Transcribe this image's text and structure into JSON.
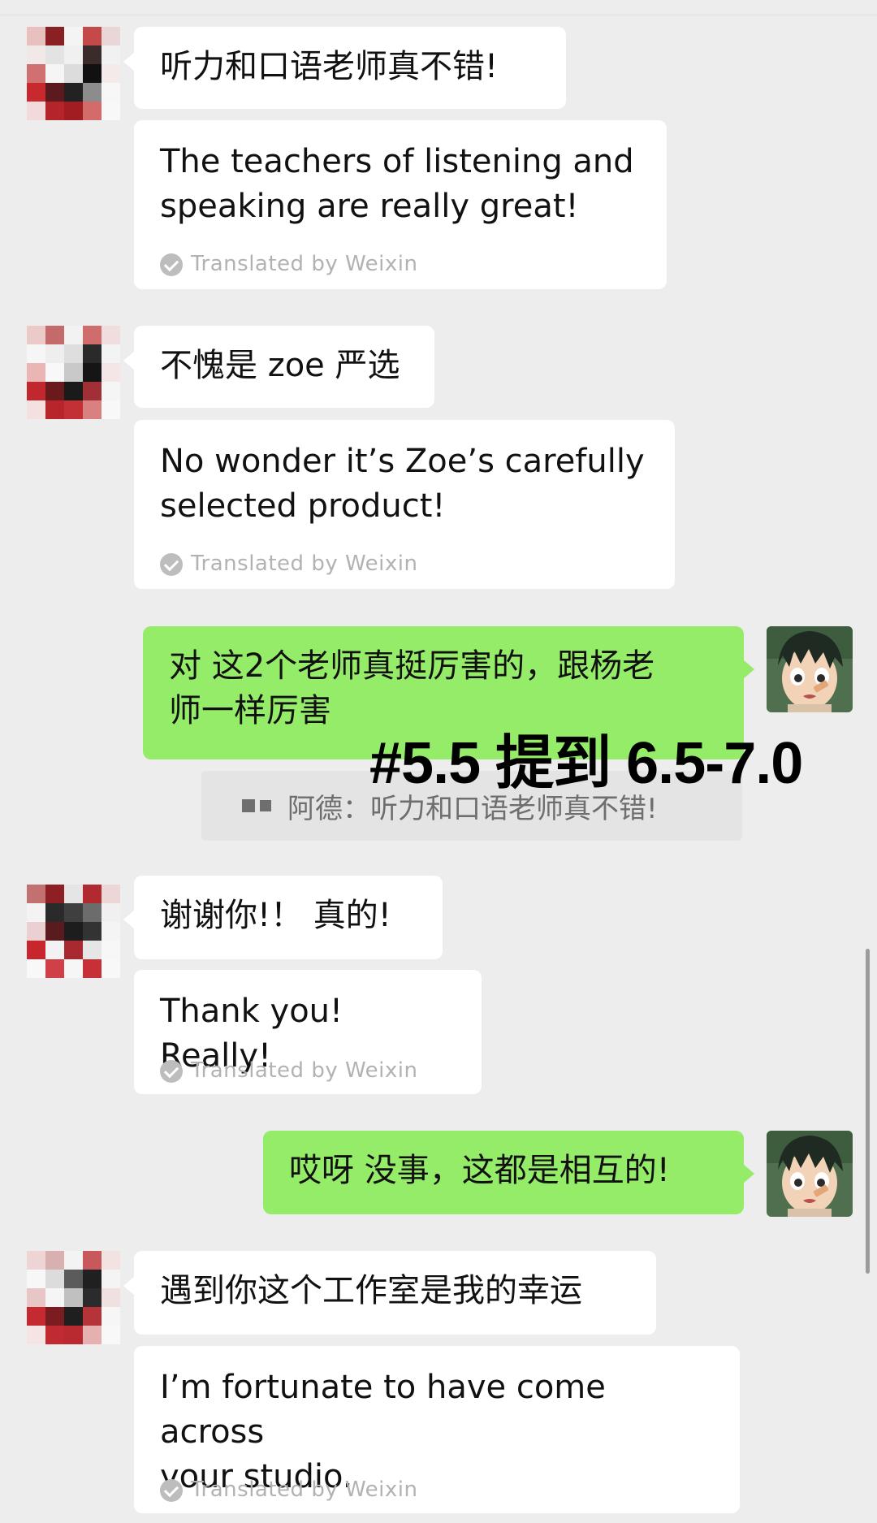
{
  "colors": {
    "background": "#ededed",
    "incoming_bubble": "#ffffff",
    "outgoing_bubble": "#95ec69",
    "translation_label": "#b2b2b2",
    "quote_background": "#e4e4e4",
    "overlay_text": "#000000"
  },
  "messages": {
    "m1": {
      "text": "听力和口语老师真不错!",
      "translation": "The teachers of listening and\nspeaking are really great!",
      "translation_label": "Translated by Weixin"
    },
    "m2": {
      "text": "不愧是 zoe 严选",
      "translation": "No wonder it’s Zoe’s carefully\nselected product!",
      "translation_label": "Translated by Weixin"
    },
    "m3": {
      "text": "对 这2个老师真挺厉害的，跟杨老\n师一样厉害",
      "quote": "阿德：听力和口语老师真不错!"
    },
    "m4": {
      "text": "谢谢你!！ 真的!",
      "translation": "Thank you! Really!",
      "translation_label": "Translated by Weixin"
    },
    "m5": {
      "text": "哎呀 没事，这都是相互的!"
    },
    "m6": {
      "text": "遇到你这个工作室是我的幸运",
      "translation": "I’m fortunate to have come across\nyour studio.",
      "translation_label": "Translated by Weixin"
    }
  },
  "overlay": {
    "text": "#5.5 提到 6.5-7.0"
  },
  "icons": {
    "check": "check-circle-icon",
    "quote": "quote-icon"
  }
}
